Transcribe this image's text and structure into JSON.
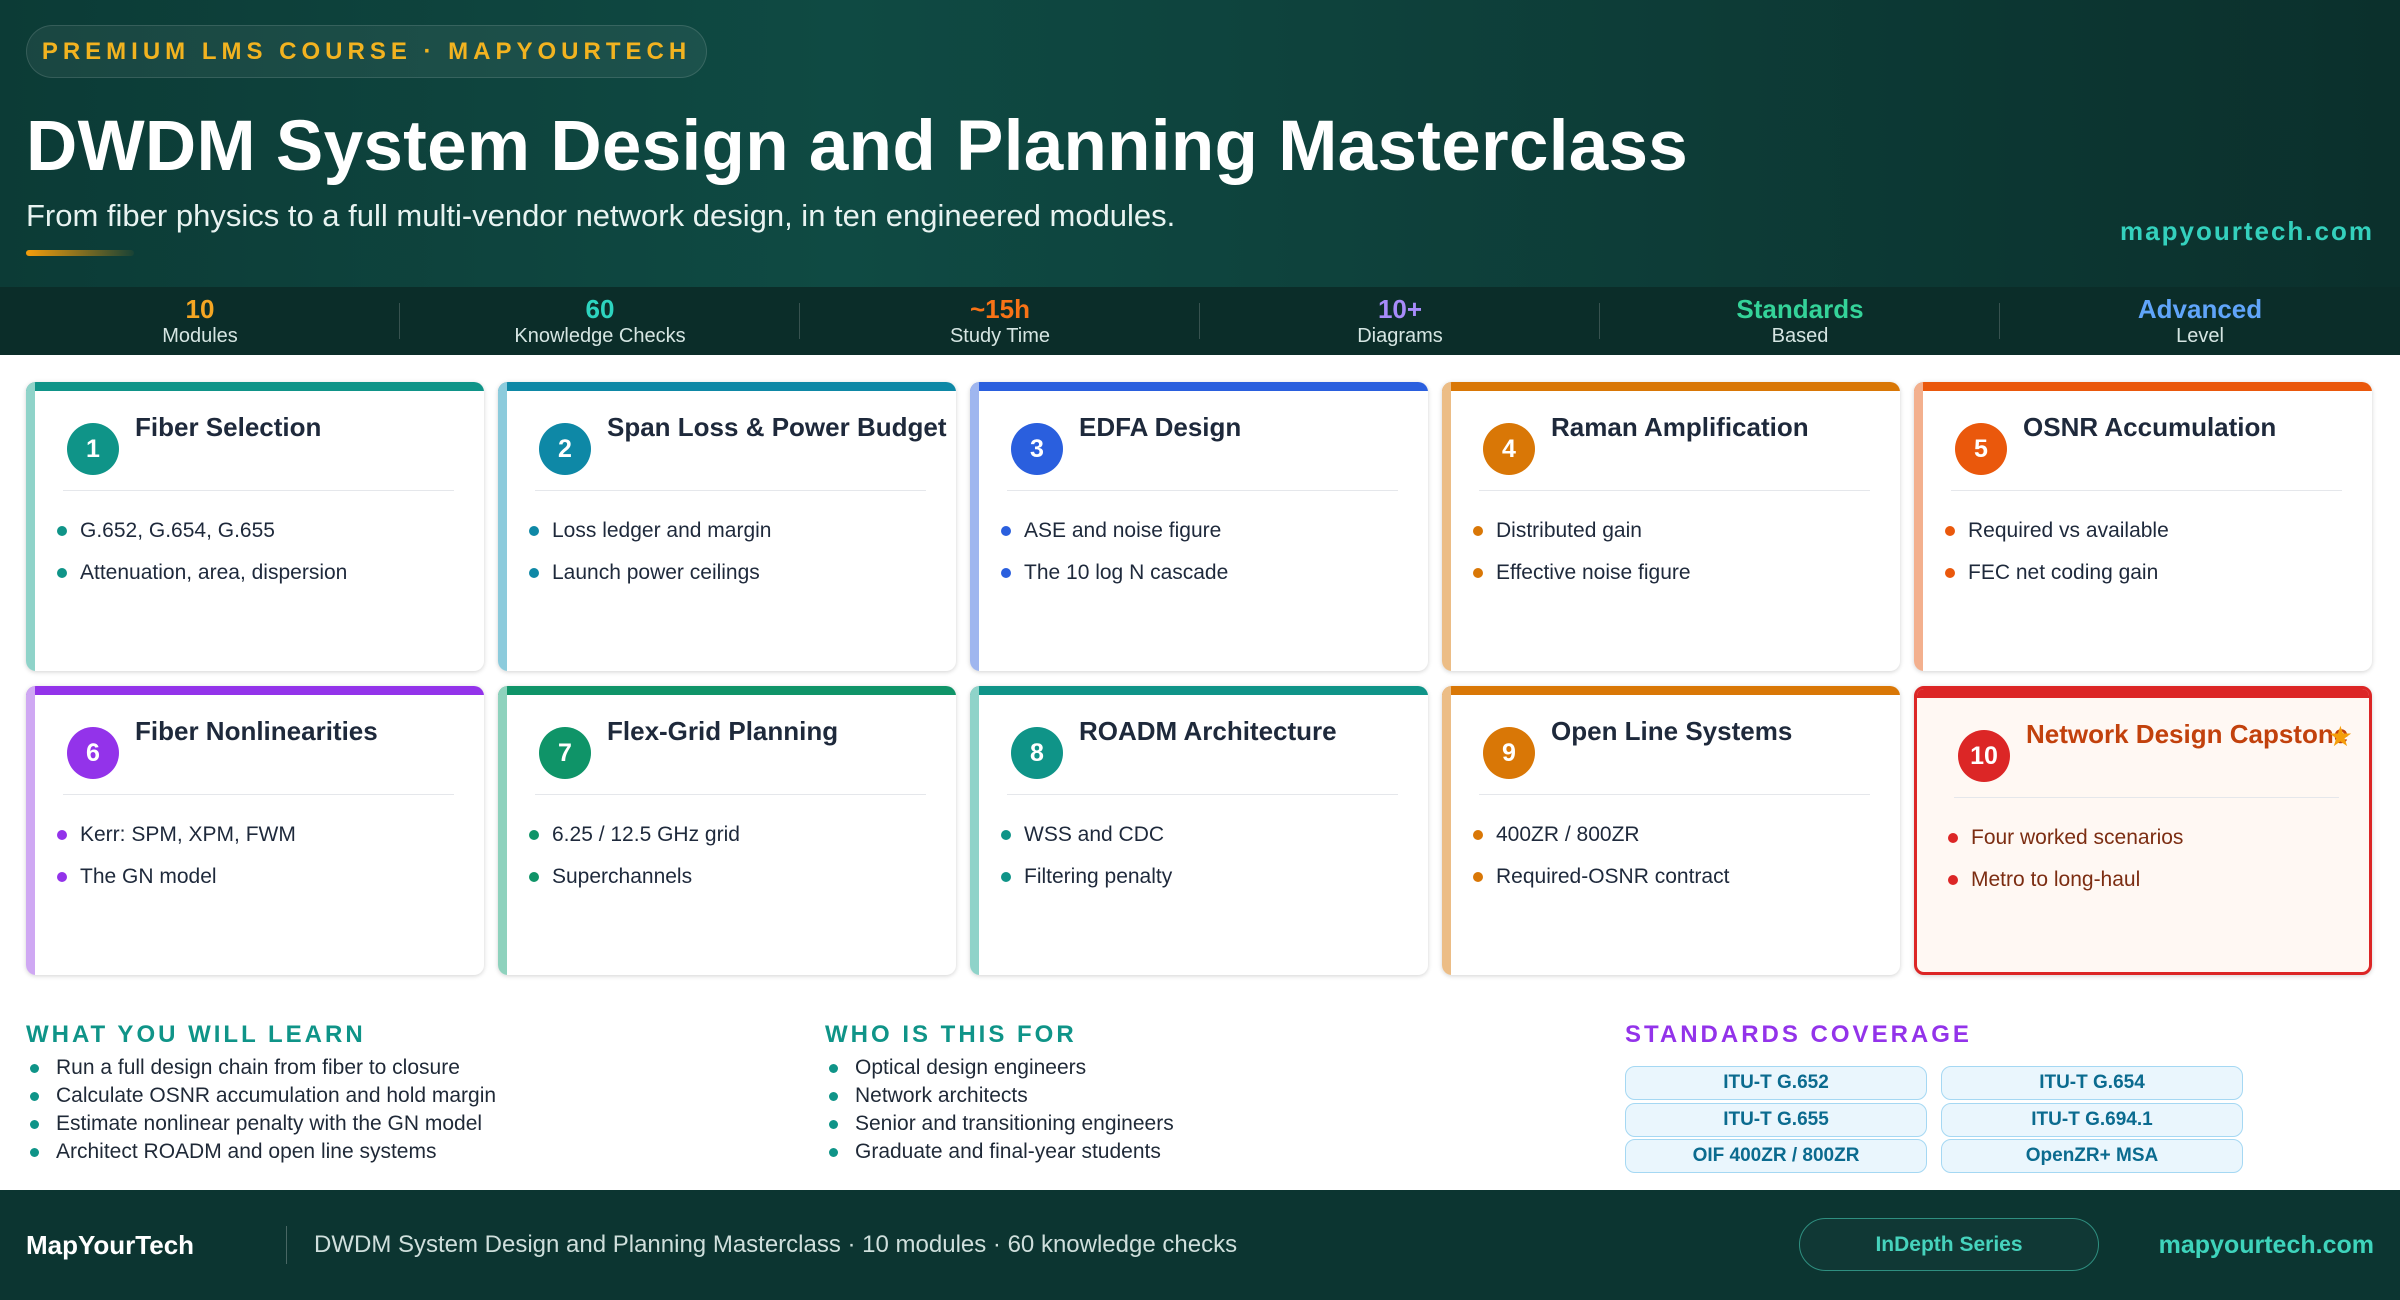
{
  "header": {
    "course_label": "PREMIUM LMS COURSE · MAPYOURTECH",
    "title": "DWDM System Design and Planning Masterclass",
    "subtitle": "From fiber physics to a full multi-vendor network design, in ten engineered modules.",
    "site": "mapyourtech.com"
  },
  "stats": [
    {
      "value": "10",
      "label": "Modules",
      "color": "#f5a623"
    },
    {
      "value": "60",
      "label": "Knowledge Checks",
      "color": "#2dd4bf"
    },
    {
      "value": "~15h",
      "label": "Study Time",
      "color": "#f97316"
    },
    {
      "value": "10+",
      "label": "Diagrams",
      "color": "#a78bfa"
    },
    {
      "value": "Standards",
      "label": "Based",
      "color": "#34d399"
    },
    {
      "value": "Advanced",
      "label": "Level",
      "color": "#60a5fa"
    }
  ],
  "modules": [
    {
      "num": "1",
      "title": "Fiber Selection",
      "bullets": [
        "G.652, G.654, G.655",
        "Attenuation, area, dispersion"
      ],
      "color": "#0f9488",
      "light": "#8fd3c9"
    },
    {
      "num": "2",
      "title": "Span Loss & Power Budget",
      "bullets": [
        "Loss ledger and margin",
        "Launch power ceilings"
      ],
      "color": "#0e88a6",
      "light": "#8ccbdc"
    },
    {
      "num": "3",
      "title": "EDFA Design",
      "bullets": [
        "ASE and noise figure",
        "The 10 log N cascade"
      ],
      "color": "#2a5fde",
      "light": "#9fb6ef"
    },
    {
      "num": "4",
      "title": "Raman Amplification",
      "bullets": [
        "Distributed gain",
        "Effective noise figure"
      ],
      "color": "#d97706",
      "light": "#ecbd86"
    },
    {
      "num": "5",
      "title": "OSNR Accumulation",
      "bullets": [
        "Required vs available",
        "FEC net coding gain"
      ],
      "color": "#ea580c",
      "light": "#f3b08e"
    },
    {
      "num": "6",
      "title": "Fiber Nonlinearities",
      "bullets": [
        "Kerr: SPM, XPM, FWM",
        "The GN model"
      ],
      "color": "#9333ea",
      "light": "#cfa8f3"
    },
    {
      "num": "7",
      "title": "Flex-Grid Planning",
      "bullets": [
        "6.25 / 12.5 GHz grid",
        "Superchannels"
      ],
      "color": "#0f9468",
      "light": "#8ed2bd"
    },
    {
      "num": "8",
      "title": "ROADM Architecture",
      "bullets": [
        "WSS and CDC",
        "Filtering penalty"
      ],
      "color": "#0f9488",
      "light": "#8fd3c9"
    },
    {
      "num": "9",
      "title": "Open Line Systems",
      "bullets": [
        "400ZR / 800ZR",
        "Required-OSNR contract"
      ],
      "color": "#d97706",
      "light": "#ecbd86"
    },
    {
      "num": "10",
      "title": "Network Design Capstone",
      "bullets": [
        "Four worked scenarios",
        "Metro to long-haul"
      ],
      "color": "#dc2626",
      "light": "#dc2626"
    }
  ],
  "learn": {
    "heading": "WHAT YOU WILL LEARN",
    "items": [
      "Run a full design chain from fiber to closure",
      "Calculate OSNR accumulation and hold margin",
      "Estimate nonlinear penalty with the GN model",
      "Architect ROADM and open line systems"
    ],
    "color": "#0f9488"
  },
  "audience": {
    "heading": "WHO IS THIS FOR",
    "items": [
      "Optical design engineers",
      "Network architects",
      "Senior and transitioning engineers",
      "Graduate and final-year students"
    ],
    "color": "#0f9488"
  },
  "standards": {
    "heading": "STANDARDS COVERAGE",
    "items": [
      "ITU-T G.652",
      "ITU-T G.654",
      "ITU-T G.655",
      "ITU-T G.694.1",
      "OIF 400ZR / 800ZR",
      "OpenZR+ MSA"
    ],
    "color": "#9333ea"
  },
  "footer": {
    "brand": "MapYourTech",
    "text": "DWDM System Design and Planning Masterclass · 10 modules · 60 knowledge checks",
    "series": "InDepth Series",
    "site": "mapyourtech.com"
  }
}
